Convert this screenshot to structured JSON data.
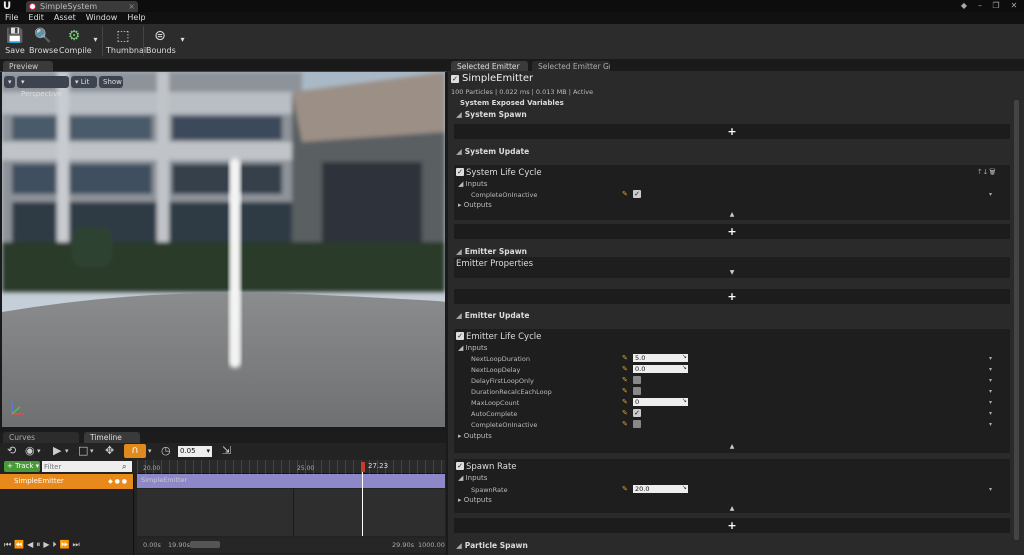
{
  "window": {
    "tab_title": "SimpleSystem"
  },
  "menu": [
    "File",
    "Edit",
    "Asset",
    "Window",
    "Help"
  ],
  "toolbar": {
    "save": "Save",
    "browse": "Browse",
    "compile": "Compile",
    "thumbnail": "Thumbnail",
    "bounds": "Bounds"
  },
  "preview": {
    "tab": "Preview",
    "perspective": "Perspective",
    "lit": "Lit",
    "show": "Show"
  },
  "tabs": {
    "selected_emitter": "Selected Emitter",
    "selected_emitter_graph": "Selected Emitter Graph",
    "curves": "Curves",
    "timeline": "Timeline"
  },
  "sequencer": {
    "track_label": "+ Track",
    "filter_placeholder": "Filter",
    "step": "0.05",
    "emitter_row": "SimpleEmitter",
    "bar_label": "SimpleEmitter",
    "tick_20": "20.00",
    "tick_25": "25.00",
    "playhead": "27.23",
    "time_start": "0.00s",
    "time_a": "19.90s",
    "time_end": "29.90s",
    "time_max": "1000.00"
  },
  "emitter": {
    "name": "SimpleEmitter",
    "stats": "100 Particles | 0.022 ms | 0.013 MB | Active",
    "exposed_vars": "System Exposed Variables",
    "sections": {
      "system_spawn": "System Spawn",
      "system_update": "System Update",
      "emitter_spawn": "Emitter Spawn",
      "emitter_update": "Emitter Update",
      "particle_spawn": "Particle Spawn"
    },
    "system_life_cycle": {
      "title": "System Life Cycle",
      "inputs": "Inputs",
      "outputs": "Outputs",
      "prop": "CompleteOnInactive"
    },
    "emitter_properties": "Emitter Properties",
    "emitter_life_cycle": {
      "title": "Emitter Life Cycle",
      "inputs": "Inputs",
      "outputs": "Outputs",
      "props": [
        {
          "label": "NextLoopDuration",
          "value": "5.0"
        },
        {
          "label": "NextLoopDelay",
          "value": "0.0"
        },
        {
          "label": "DelayFirstLoopOnly",
          "checked": false
        },
        {
          "label": "DurationRecalcEachLoop",
          "checked": false
        },
        {
          "label": "MaxLoopCount",
          "value": "0"
        },
        {
          "label": "AutoComplete",
          "checked": true
        },
        {
          "label": "CompleteOnInactive",
          "checked": false
        }
      ]
    },
    "spawn_rate": {
      "title": "Spawn Rate",
      "inputs": "Inputs",
      "outputs": "Outputs",
      "prop": "SpawnRate",
      "value": "20.0"
    }
  },
  "plus": "+",
  "icons": {
    "logo": "unreal-logo",
    "save": "save-icon",
    "browse": "browse-icon",
    "compile": "compile-icon",
    "thumbnail": "thumbnail-icon",
    "bounds": "bounds-icon"
  }
}
